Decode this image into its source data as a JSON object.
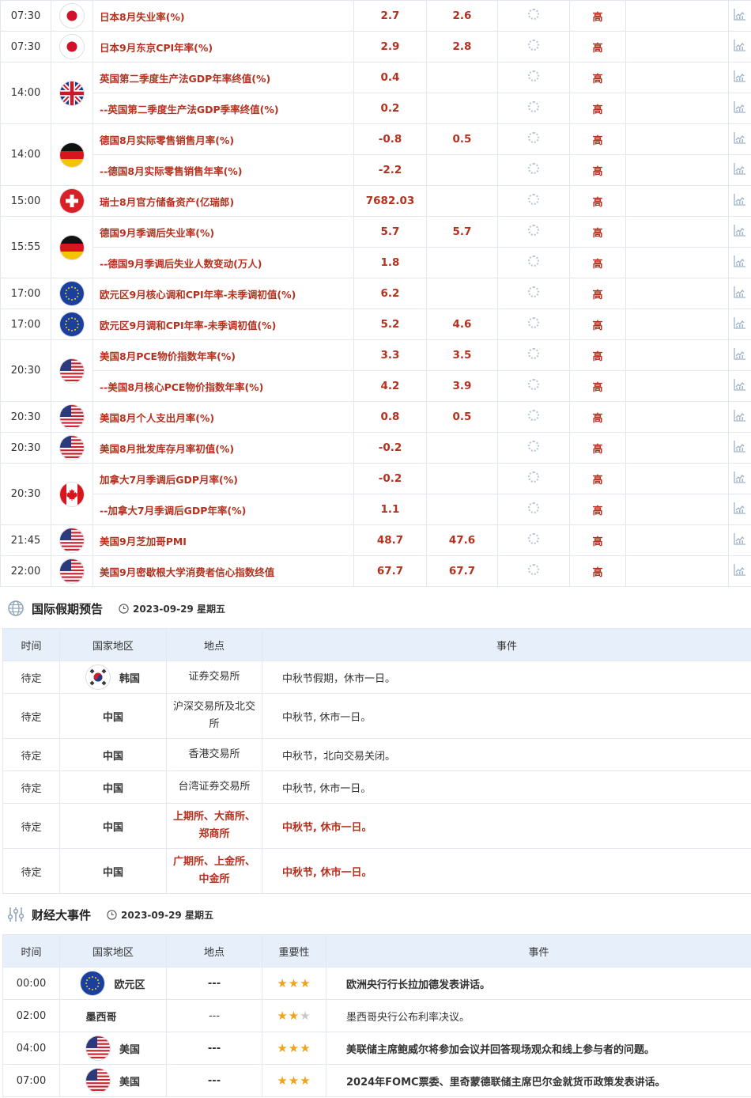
{
  "econ_rows": [
    {
      "time": "07:30",
      "flag": "jp",
      "name": "日本8月失业率(%)",
      "actual": "2.7",
      "forecast": "2.6",
      "importance": "高"
    },
    {
      "time": "07:30",
      "flag": "jp",
      "name": "日本9月东京CPI年率(%)",
      "actual": "2.9",
      "forecast": "2.8",
      "importance": "高"
    },
    {
      "time": "14:00",
      "flag": "gb",
      "name": "英国第二季度生产法GDP年率终值(%)",
      "actual": "0.4",
      "forecast": "",
      "importance": "高"
    },
    {
      "time": "",
      "flag": "",
      "name": "--英国第二季度生产法GDP季率终值(%)",
      "actual": "0.2",
      "forecast": "",
      "importance": "高"
    },
    {
      "time": "14:00",
      "flag": "de",
      "name": "德国8月实际零售销售月率(%)",
      "actual": "-0.8",
      "forecast": "0.5",
      "importance": "高"
    },
    {
      "time": "",
      "flag": "",
      "name": "--德国8月实际零售销售年率(%)",
      "actual": "-2.2",
      "forecast": "",
      "importance": "高"
    },
    {
      "time": "15:00",
      "flag": "ch",
      "name": "瑞士8月官方储备资产(亿瑞郎)",
      "actual": "7682.03",
      "forecast": "",
      "importance": "高"
    },
    {
      "time": "15:55",
      "flag": "de",
      "name": "德国9月季调后失业率(%)",
      "actual": "5.7",
      "forecast": "5.7",
      "importance": "高"
    },
    {
      "time": "",
      "flag": "",
      "name": "--德国9月季调后失业人数变动(万人)",
      "actual": "1.8",
      "forecast": "",
      "importance": "高"
    },
    {
      "time": "17:00",
      "flag": "eu",
      "name": "欧元区9月核心调和CPI年率-未季调初值(%)",
      "actual": "6.2",
      "forecast": "",
      "importance": "高"
    },
    {
      "time": "17:00",
      "flag": "eu",
      "name": "欧元区9月调和CPI年率-未季调初值(%)",
      "actual": "5.2",
      "forecast": "4.6",
      "importance": "高"
    },
    {
      "time": "20:30",
      "flag": "us",
      "name": "美国8月PCE物价指数年率(%)",
      "actual": "3.3",
      "forecast": "3.5",
      "importance": "高"
    },
    {
      "time": "",
      "flag": "",
      "name": "--美国8月核心PCE物价指数年率(%)",
      "actual": "4.2",
      "forecast": "3.9",
      "importance": "高"
    },
    {
      "time": "20:30",
      "flag": "us",
      "name": "美国8月个人支出月率(%)",
      "actual": "0.8",
      "forecast": "0.5",
      "importance": "高"
    },
    {
      "time": "20:30",
      "flag": "us",
      "name": "美国8月批发库存月率初值(%)",
      "actual": "-0.2",
      "forecast": "",
      "importance": "高"
    },
    {
      "time": "20:30",
      "flag": "ca",
      "name": "加拿大7月季调后GDP月率(%)",
      "actual": "-0.2",
      "forecast": "",
      "importance": "高"
    },
    {
      "time": "",
      "flag": "",
      "name": "--加拿大7月季调后GDP年率(%)",
      "actual": "1.1",
      "forecast": "",
      "importance": "高"
    },
    {
      "time": "21:45",
      "flag": "us",
      "name": "美国9月芝加哥PMI",
      "actual": "48.7",
      "forecast": "47.6",
      "importance": "高"
    },
    {
      "time": "22:00",
      "flag": "us",
      "name": "美国9月密歇根大学消费者信心指数终值",
      "actual": "67.7",
      "forecast": "67.7",
      "importance": "高"
    }
  ],
  "holiday": {
    "title": "国际假期预告",
    "date": "2023-09-29 星期五",
    "headers": [
      "时间",
      "国家地区",
      "地点",
      "事件"
    ],
    "rows": [
      {
        "time": "待定",
        "flag": "kr",
        "country": "韩国",
        "place": "证券交易所",
        "event": "中秋节假期，休市一日。",
        "red": false
      },
      {
        "time": "待定",
        "flag": "",
        "country": "中国",
        "place": "沪深交易所及北交所",
        "event": "中秋节, 休市一日。",
        "red": false
      },
      {
        "time": "待定",
        "flag": "",
        "country": "中国",
        "place": "香港交易所",
        "event": "中秋节，北向交易关闭。",
        "red": false
      },
      {
        "time": "待定",
        "flag": "",
        "country": "中国",
        "place": "台湾证券交易所",
        "event": "中秋节, 休市一日。",
        "red": false
      },
      {
        "time": "待定",
        "flag": "",
        "country": "中国",
        "place": "上期所、大商所、郑商所",
        "event": "中秋节, 休市一日。",
        "red": true
      },
      {
        "time": "待定",
        "flag": "",
        "country": "中国",
        "place": "广期所、上金所、中金所",
        "event": "中秋节, 休市一日。",
        "red": true
      }
    ]
  },
  "events": {
    "title": "财经大事件",
    "date": "2023-09-29 星期五",
    "headers": [
      "时间",
      "国家地区",
      "地点",
      "重要性",
      "事件"
    ],
    "rows": [
      {
        "time": "00:00",
        "flag": "eu",
        "country": "欧元区",
        "place": "---",
        "stars": 3,
        "event": "欧洲央行行长拉加德发表讲话。",
        "red": true
      },
      {
        "time": "02:00",
        "flag": "",
        "country": "墨西哥",
        "place": "---",
        "stars": 2,
        "event": "墨西哥央行公布利率决议。",
        "red": false
      },
      {
        "time": "04:00",
        "flag": "us",
        "country": "美国",
        "place": "---",
        "stars": 3,
        "event": "美联储主席鲍威尔将参加会议并回答现场观众和线上参与者的问题。",
        "red": true
      },
      {
        "time": "07:00",
        "flag": "us",
        "country": "美国",
        "place": "---",
        "stars": 3,
        "event": "2024年FOMC票委、里奇蒙德联储主席巴尔金就货币政策发表讲话。",
        "red": true
      }
    ]
  },
  "colors": {
    "accent_red": "#b5311f",
    "header_bg": "#e7f0fa",
    "star": "#f3a21b"
  }
}
